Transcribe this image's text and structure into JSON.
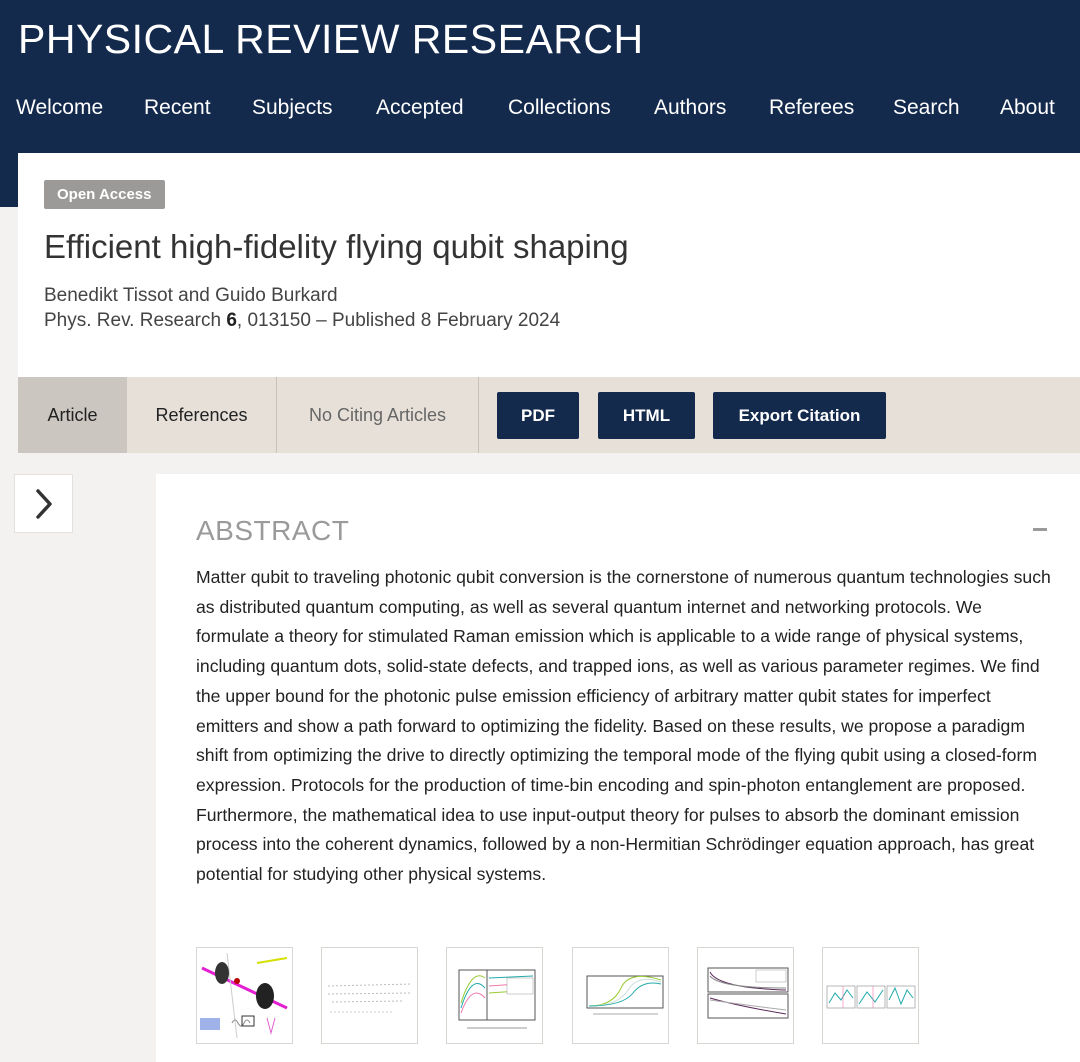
{
  "site": {
    "title": "PHYSICAL REVIEW RESEARCH"
  },
  "nav": {
    "items": [
      "Welcome",
      "Recent",
      "Subjects",
      "Accepted",
      "Collections",
      "Authors",
      "Referees",
      "Search",
      "About"
    ]
  },
  "article": {
    "badge": "Open Access",
    "title": "Efficient high-fidelity flying qubit shaping",
    "authors": "Benedikt Tissot and Guido Burkard",
    "journal": "Phys. Rev. Research",
    "volume": "6",
    "citation_rest": ", 013150 – Published 8 February 2024"
  },
  "tabs": {
    "article": "Article",
    "references": "References",
    "citing": "No Citing Articles"
  },
  "buttons": {
    "pdf": "PDF",
    "html": "HTML",
    "export": "Export Citation"
  },
  "abstract": {
    "heading": "ABSTRACT",
    "text": "Matter qubit to traveling photonic qubit conversion is the cornerstone of numerous quantum technologies such as distributed quantum computing, as well as several quantum internet and networking protocols. We formulate a theory for stimulated Raman emission which is applicable to a wide range of physical systems, including quantum dots, solid-state defects, and trapped ions, as well as various parameter regimes. We find the upper bound for the photonic pulse emission efficiency of arbitrary matter qubit states for imperfect emitters and show a path forward to optimizing the fidelity. Based on these results, we propose a paradigm shift from optimizing the drive to directly optimizing the temporal mode of the flying qubit using a closed-form expression. Protocols for the production of time-bin encoding and spin-photon entanglement are proposed. Furthermore, the mathematical idea to use input-output theory for pulses to absorb the dominant emission process into the coherent dynamics, followed by a non-Hermitian Schrödinger equation approach, has great potential for studying other physical systems."
  },
  "icons": {
    "sidebar_toggle": "chevron-right-icon",
    "collapse": "minus-icon"
  },
  "colors": {
    "brand_navy": "#142a4d",
    "tab_bar": "#e6e0d9",
    "tab_active": "#cbc6c0",
    "badge_gray": "#9b9a98"
  }
}
